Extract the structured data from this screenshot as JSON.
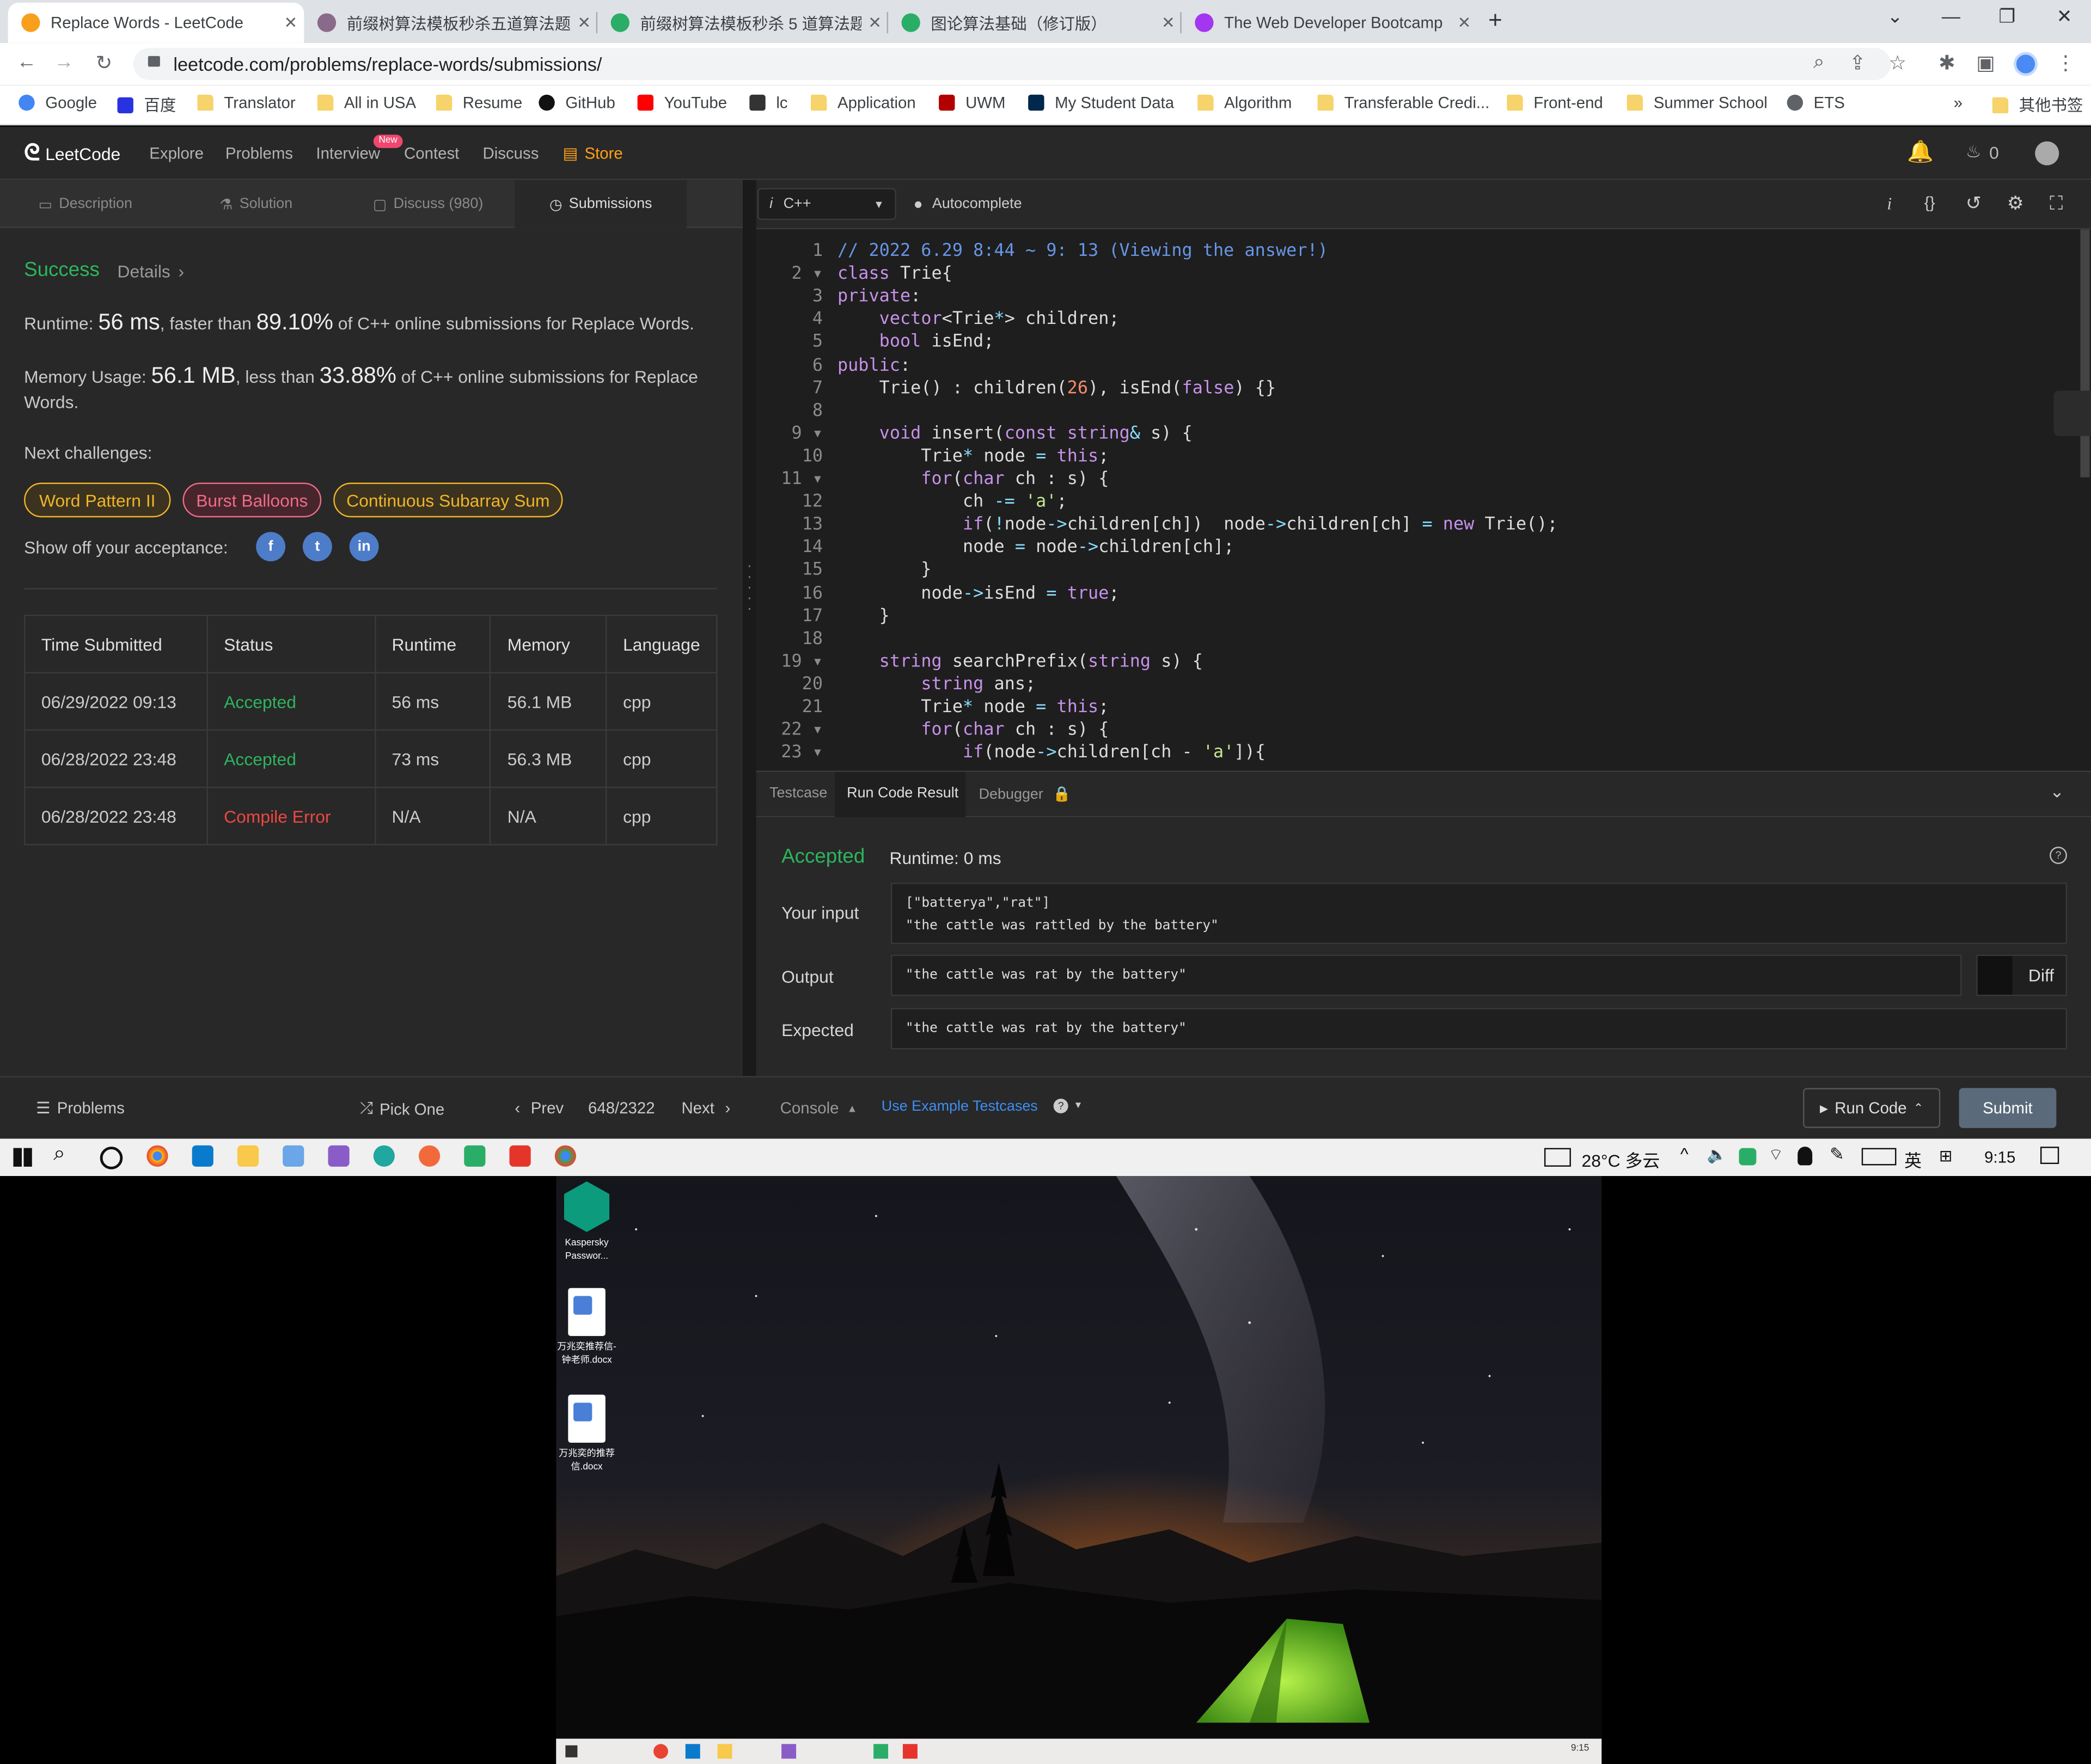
{
  "browser": {
    "tabs": [
      {
        "title": "Replace Words - LeetCode",
        "active": true,
        "favicon_color": "#f89f1b"
      },
      {
        "title": "前缀树算法模板秒杀五道算法题",
        "active": false,
        "favicon_color": "#8a6a8a"
      },
      {
        "title": "前缀树算法模板秒杀 5 道算法题",
        "active": false,
        "favicon_color": "#2aae67"
      },
      {
        "title": "图论算法基础（修订版）",
        "active": false,
        "favicon_color": "#2aae67"
      },
      {
        "title": "The Web Developer Bootcamp",
        "active": false,
        "favicon_color": "#a435f0"
      }
    ],
    "new_tab": "+",
    "url": "leetcode.com/problems/replace-words/submissions/",
    "bookmarks": [
      {
        "label": "Google",
        "icon": "google-icon"
      },
      {
        "label": "百度",
        "icon": "baidu-icon"
      },
      {
        "label": "Translator",
        "icon": "folder-icon"
      },
      {
        "label": "All in USA",
        "icon": "folder-icon"
      },
      {
        "label": "Resume",
        "icon": "folder-icon"
      },
      {
        "label": "GitHub",
        "icon": "github-icon"
      },
      {
        "label": "YouTube",
        "icon": "youtube-icon"
      },
      {
        "label": "lc",
        "icon": "leetcode-icon"
      },
      {
        "label": "Application",
        "icon": "folder-icon"
      },
      {
        "label": "UWM",
        "icon": "uwm-icon"
      },
      {
        "label": "My Student Data",
        "icon": "michigan-icon"
      },
      {
        "label": "Algorithm",
        "icon": "folder-icon"
      },
      {
        "label": "Transferable Credi...",
        "icon": "folder-icon"
      },
      {
        "label": "Front-end",
        "icon": "folder-icon"
      },
      {
        "label": "Summer School",
        "icon": "folder-icon"
      },
      {
        "label": "ETS",
        "icon": "globe-icon"
      }
    ],
    "bookmarks_more": "»",
    "other_bookmarks": "其他书签"
  },
  "lc_nav": {
    "logo": "LeetCode",
    "links": [
      "Explore",
      "Problems",
      "Interview",
      "Contest",
      "Discuss"
    ],
    "new_badge": "New",
    "store": "Store",
    "fire_count": "0"
  },
  "left_tabs": [
    {
      "label": "Description",
      "icon": "document-icon"
    },
    {
      "label": "Solution",
      "icon": "flask-icon"
    },
    {
      "label": "Discuss (980)",
      "icon": "chat-icon"
    },
    {
      "label": "Submissions",
      "icon": "clock-icon"
    }
  ],
  "result": {
    "status": "Success",
    "details": "Details",
    "runtime_prefix": "Runtime: ",
    "runtime_value": "56 ms",
    "runtime_mid": ", faster than ",
    "runtime_pct": "89.10%",
    "runtime_suffix": " of C++ online submissions for Replace Words.",
    "memory_prefix": "Memory Usage: ",
    "memory_value": "56.1 MB",
    "memory_mid": ", less than ",
    "memory_pct": "33.88%",
    "memory_suffix": " of C++ online submissions for Replace Words.",
    "next_challenges": "Next challenges:",
    "challenges": [
      {
        "label": "Word Pattern II",
        "color": "#f0b429"
      },
      {
        "label": "Burst Balloons",
        "color": "#ef6b88"
      },
      {
        "label": "Continuous Subarray Sum",
        "color": "#f0b429"
      }
    ],
    "show_off": "Show off your acceptance:"
  },
  "submissions": {
    "headers": [
      "Time Submitted",
      "Status",
      "Runtime",
      "Memory",
      "Language"
    ],
    "rows": [
      {
        "time": "06/29/2022 09:13",
        "status": "Accepted",
        "runtime": "56 ms",
        "memory": "56.1 MB",
        "language": "cpp"
      },
      {
        "time": "06/28/2022 23:48",
        "status": "Accepted",
        "runtime": "73 ms",
        "memory": "56.3 MB",
        "language": "cpp"
      },
      {
        "time": "06/28/2022 23:48",
        "status": "Compile Error",
        "runtime": "N/A",
        "memory": "N/A",
        "language": "cpp"
      }
    ]
  },
  "editor": {
    "language": "C++",
    "autocomplete": "Autocomplete",
    "lines": [
      "// 2022 6.29 8:44 ~ 9: 13 (Viewing the answer!)",
      "class Trie{",
      "private:",
      "    vector<Trie*> children;",
      "    bool isEnd;",
      "public:",
      "    Trie() : children(26), isEnd(false) {}",
      "",
      "    void insert(const string& s) {",
      "        Trie* node = this;",
      "        for(char ch : s) {",
      "            ch -= 'a';",
      "            if(!node->children[ch])  node->children[ch] = new Trie();",
      "            node = node->children[ch];",
      "        }",
      "        node->isEnd = true;",
      "    }",
      "",
      "    string searchPrefix(string s) {",
      "        string ans;",
      "        Trie* node = this;",
      "        for(char ch : s) {",
      "            if(node->children[ch - 'a']){"
    ],
    "fold_lines": [
      2,
      9,
      11,
      19,
      22,
      23
    ]
  },
  "console": {
    "tabs": [
      "Testcase",
      "Run Code Result",
      "Debugger"
    ],
    "status": "Accepted",
    "runtime": "Runtime: 0 ms",
    "input_label": "Your input",
    "input_value": "[\"batterya\",\"rat\"]\n\"the cattle was rattled by the battery\"",
    "output_label": "Output",
    "output_value": "\"the cattle was rat by the battery\"",
    "diff": "Diff",
    "expected_label": "Expected",
    "expected_value": "\"the cattle was rat by the battery\""
  },
  "bottom": {
    "problems": "Problems",
    "pick_one": "Pick One",
    "prev": "Prev",
    "counter": "648/2322",
    "next": "Next",
    "console": "Console",
    "use_example": "Use Example Testcases",
    "run_code": "Run Code",
    "submit": "Submit"
  },
  "taskbar": {
    "weather": "28°C 多云",
    "ime": "英",
    "time": "9:15"
  },
  "desktop": {
    "icons": [
      {
        "label": "Kaspersky Passwor..."
      },
      {
        "label": "万兆奕推荐信-钟老师.docx"
      },
      {
        "label": "万兆奕的推荐信.docx"
      }
    ],
    "mini_time": "9:15"
  }
}
